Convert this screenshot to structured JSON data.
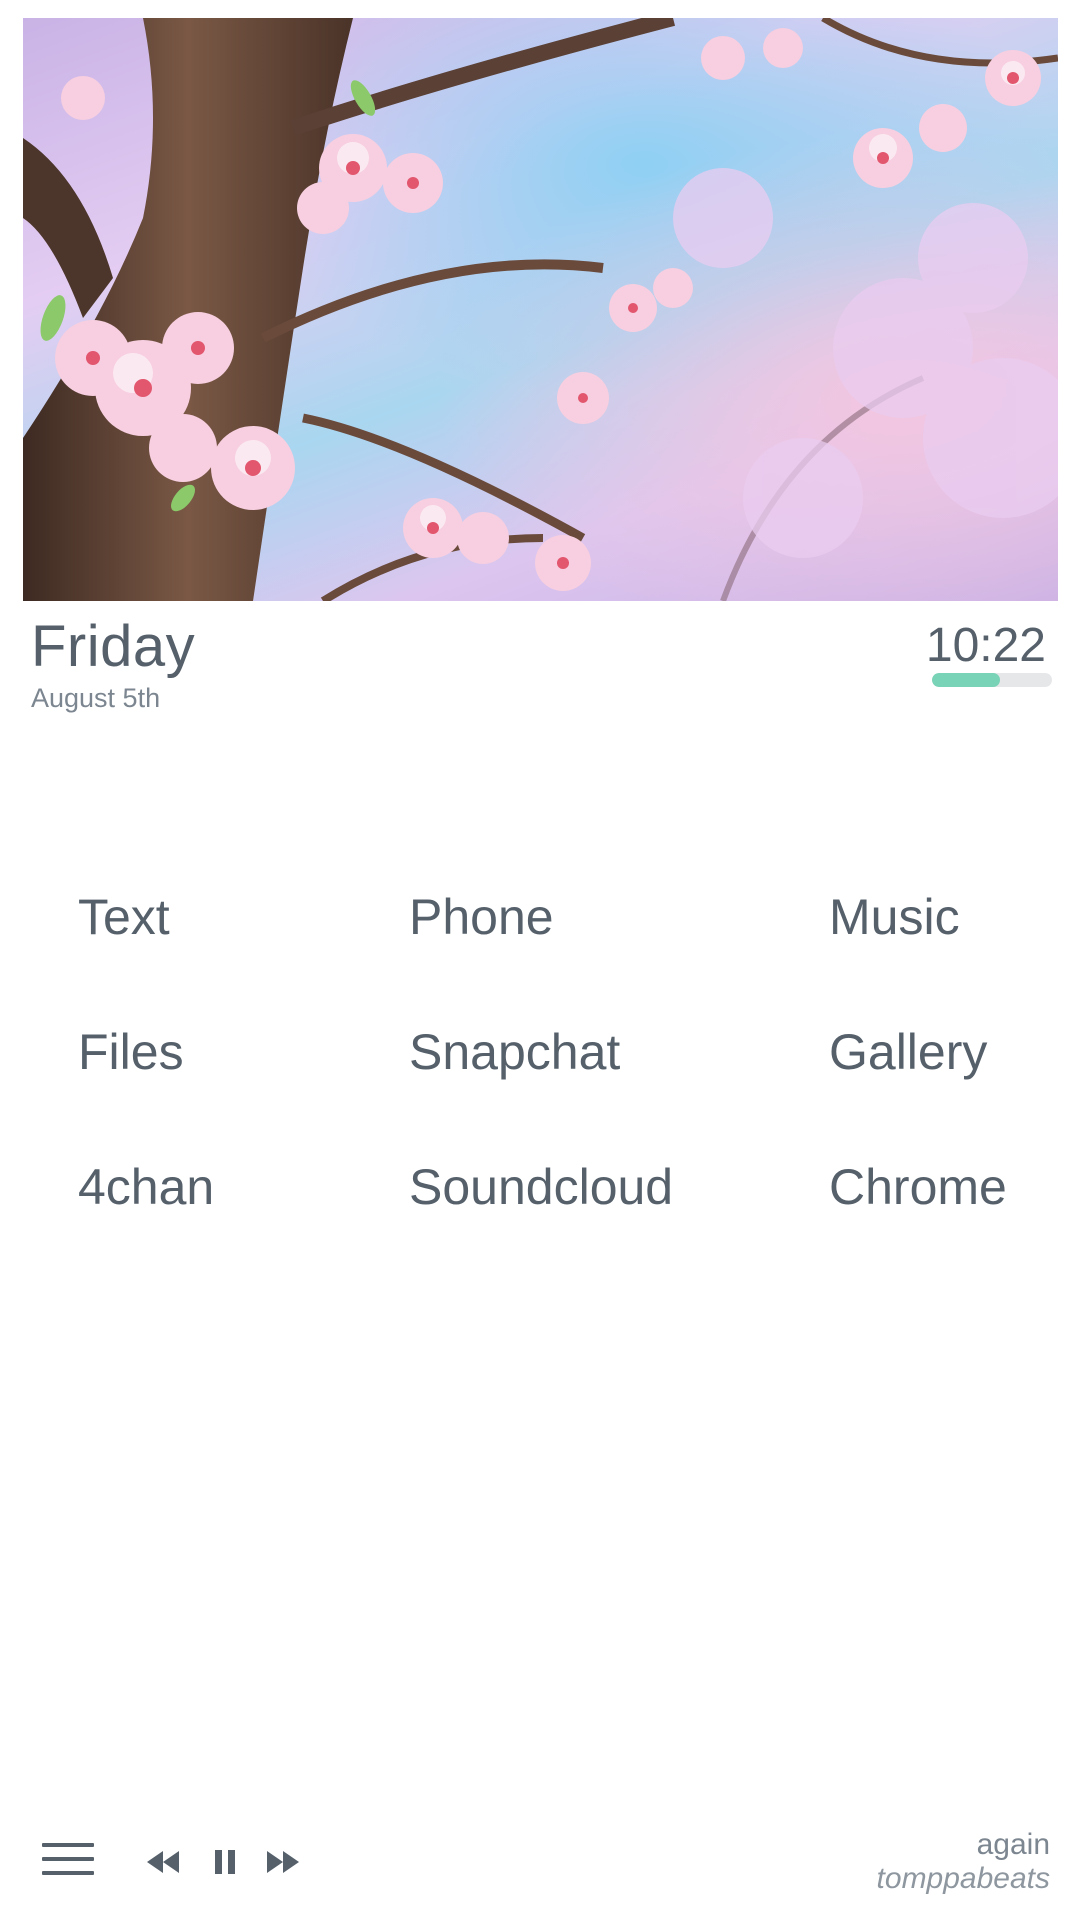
{
  "header": {
    "day": "Friday",
    "date": "August 5th",
    "time": "10:22",
    "battery_level": 0.57
  },
  "apps": [
    {
      "label": "Text"
    },
    {
      "label": "Phone"
    },
    {
      "label": "Music"
    },
    {
      "label": "Files"
    },
    {
      "label": "Snapchat"
    },
    {
      "label": "Gallery"
    },
    {
      "label": "4chan"
    },
    {
      "label": "Soundcloud"
    },
    {
      "label": "Chrome"
    }
  ],
  "player": {
    "title": "again",
    "artist": "tomppabeats"
  },
  "colors": {
    "text": "#55606b",
    "accent": "#79d3b6",
    "track_bg": "#e5e7e9"
  },
  "icons": [
    "menu-icon",
    "rewind-icon",
    "pause-icon",
    "fast-forward-icon"
  ]
}
